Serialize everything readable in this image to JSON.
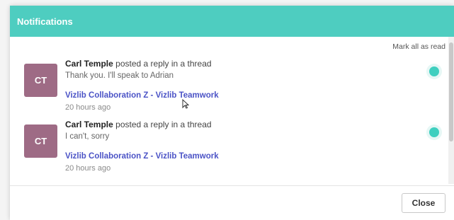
{
  "header": {
    "title": "Notifications"
  },
  "mark_all_label": "Mark all as read",
  "notifications": [
    {
      "initials": "CT",
      "author": "Carl Temple",
      "action": "posted a reply in a thread",
      "message": "Thank you. I'll speak to Adrian",
      "thread": "Vizlib Collaboration Z - Vizlib Teamwork",
      "time": "20 hours ago"
    },
    {
      "initials": "CT",
      "author": "Carl Temple",
      "action": "posted a reply in a thread",
      "message": "I can't, sorry",
      "thread": "Vizlib Collaboration Z - Vizlib Teamwork",
      "time": "20 hours ago"
    }
  ],
  "footer": {
    "close_label": "Close"
  },
  "colors": {
    "header": "#4ecdc0",
    "avatar": "#9e6b85",
    "link": "#4b53c6",
    "unread": "#3ecfbf"
  }
}
